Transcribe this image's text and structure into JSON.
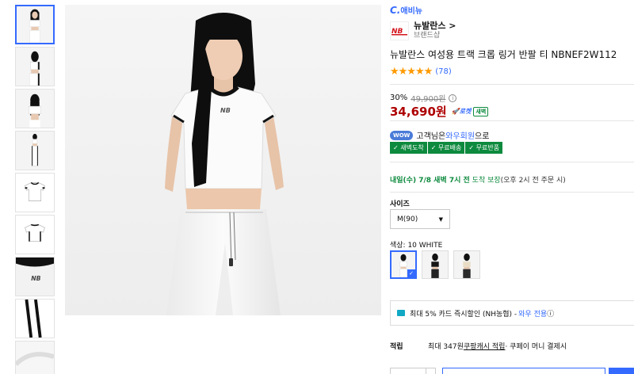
{
  "thumbnails": [
    {
      "name": "thumb-1",
      "kind": "model-front"
    },
    {
      "name": "thumb-2",
      "kind": "model-side"
    },
    {
      "name": "thumb-3",
      "kind": "model-back"
    },
    {
      "name": "thumb-4",
      "kind": "model-full"
    },
    {
      "name": "thumb-5",
      "kind": "tee-flat"
    },
    {
      "name": "thumb-6",
      "kind": "tee-flat"
    },
    {
      "name": "thumb-7",
      "kind": "tee-logo"
    },
    {
      "name": "thumb-8",
      "kind": "stripe-detail"
    },
    {
      "name": "thumb-9",
      "kind": "fabric"
    }
  ],
  "seller_logo": {
    "prefix": "C.",
    "text": "애비뉴"
  },
  "brand": {
    "name": "뉴발란스 >",
    "subtitle": "브랜드샵",
    "logo_icon": "new-balance-logo"
  },
  "product": {
    "title": "뉴발란스 여성용 트랙 크롭 링거 반팔 티 NBNEF2W112",
    "stars": "★★★★★",
    "review_count": "(78)"
  },
  "pricing": {
    "discount": "30%",
    "original_price": "49,900원",
    "info_icon": "i",
    "sale_price": "34,690원",
    "rocket_label": "🚀로켓",
    "night_label": "새벽"
  },
  "wow": {
    "badge": "WOW",
    "text_before": "고객님은 ",
    "member_text": "와우회원",
    "text_after": "으로",
    "benefits": [
      "✓ 새벽도착",
      "✓ 무료배송",
      "✓ 무료반품"
    ]
  },
  "delivery": {
    "date": "내일(수) 7/8 새벽 7시 전",
    "guarantee": " 도착 보장",
    "condition": "(오후 2시 전 주문 시)"
  },
  "size": {
    "label": "사이즈",
    "selected": "M(90)",
    "caret": "▼"
  },
  "color": {
    "label": "색상: 10 WHITE",
    "check": "✓"
  },
  "card_promo": {
    "text": "최대 5% 카드 즉시할인 (NH농협) -",
    "highlight": "와우 전용",
    "info": "ⓘ"
  },
  "reward": {
    "label": "적립",
    "prefix": "최대 347원 ",
    "link": "쿠팡캐시 적립",
    "suffix": " · 쿠페이 머니 결제시"
  },
  "colors": {
    "accent": "#346aff",
    "price_red": "#ae0000",
    "green": "#0d8a3e",
    "star": "#ff9a00"
  }
}
